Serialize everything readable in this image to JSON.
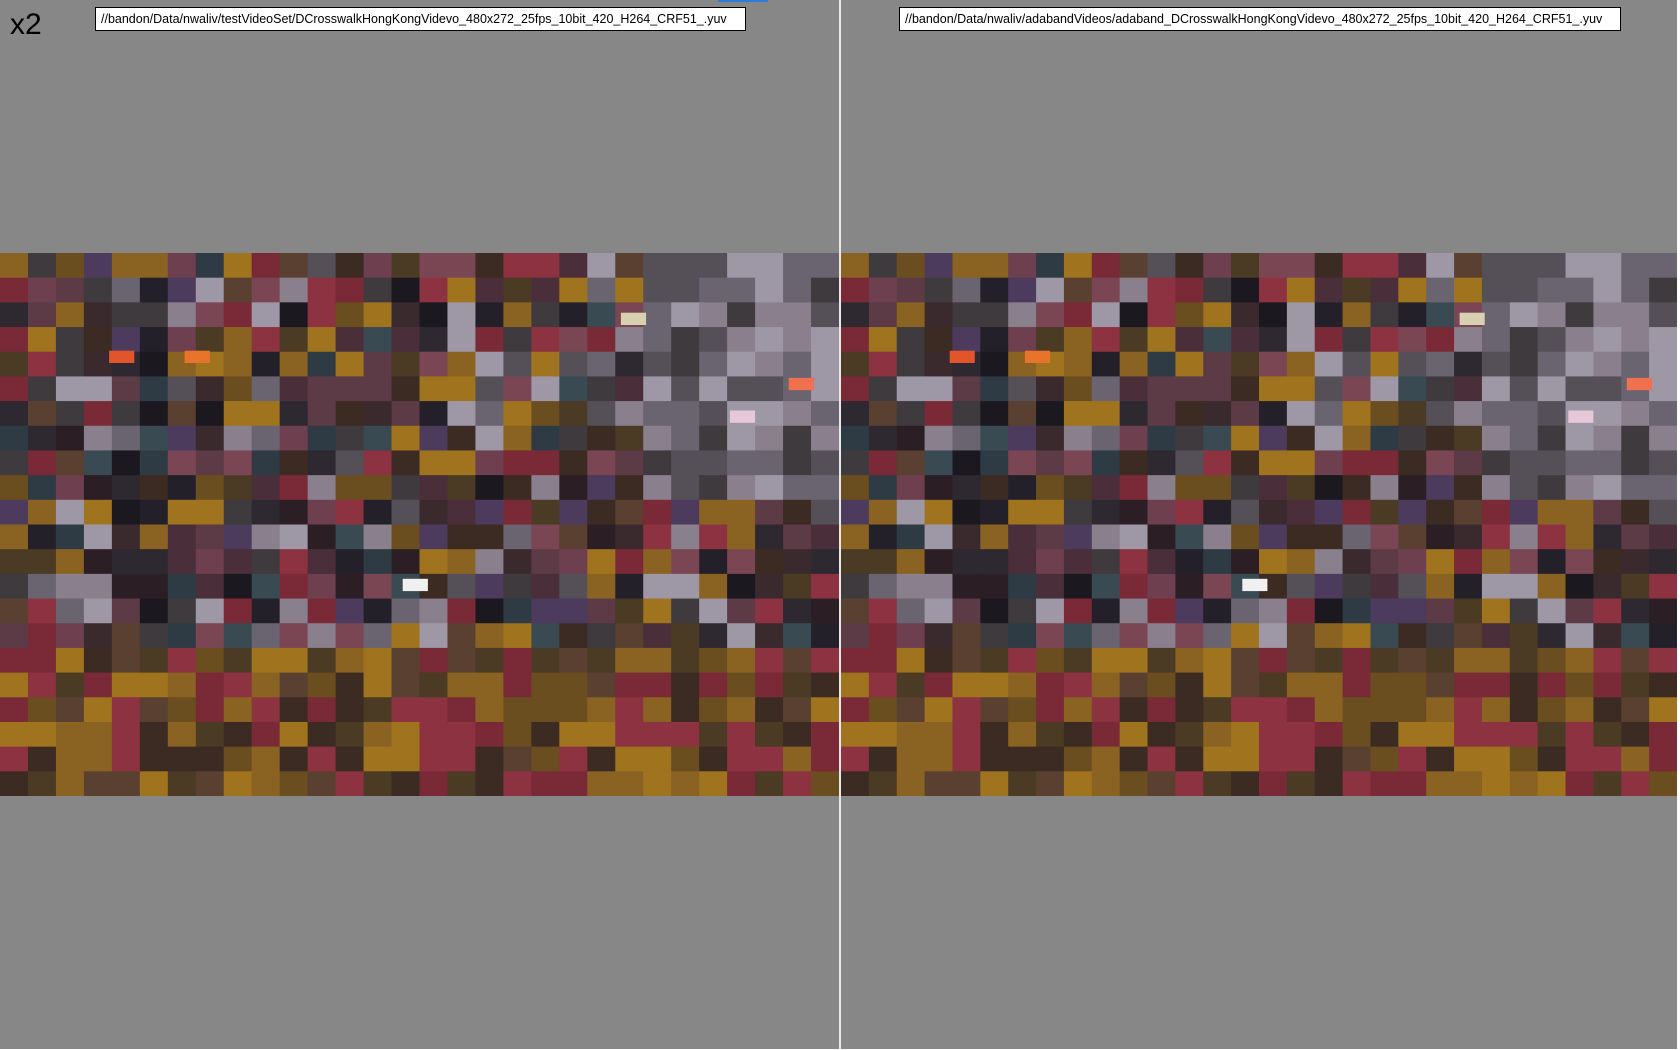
{
  "zoom_label": "x2",
  "left_pane": {
    "file_path": "//bandon/Data/nwaliv/testVideoSet/DCrosswalkHongKongVidevo_480x272_25fps_10bit_420_H264_CRF51_.yuv"
  },
  "right_pane": {
    "file_path": "//bandon/Data/nwaliv/adabandVideos/adaband_DCrosswalkHongKongVidevo_480x272_25fps_10bit_420_H264_CRF51_.yuv"
  },
  "icons": [
    "video-frame"
  ],
  "colors": {
    "background": "#878787",
    "divider": "#e8e8e8",
    "selection_mark": "#2e7cd6"
  }
}
